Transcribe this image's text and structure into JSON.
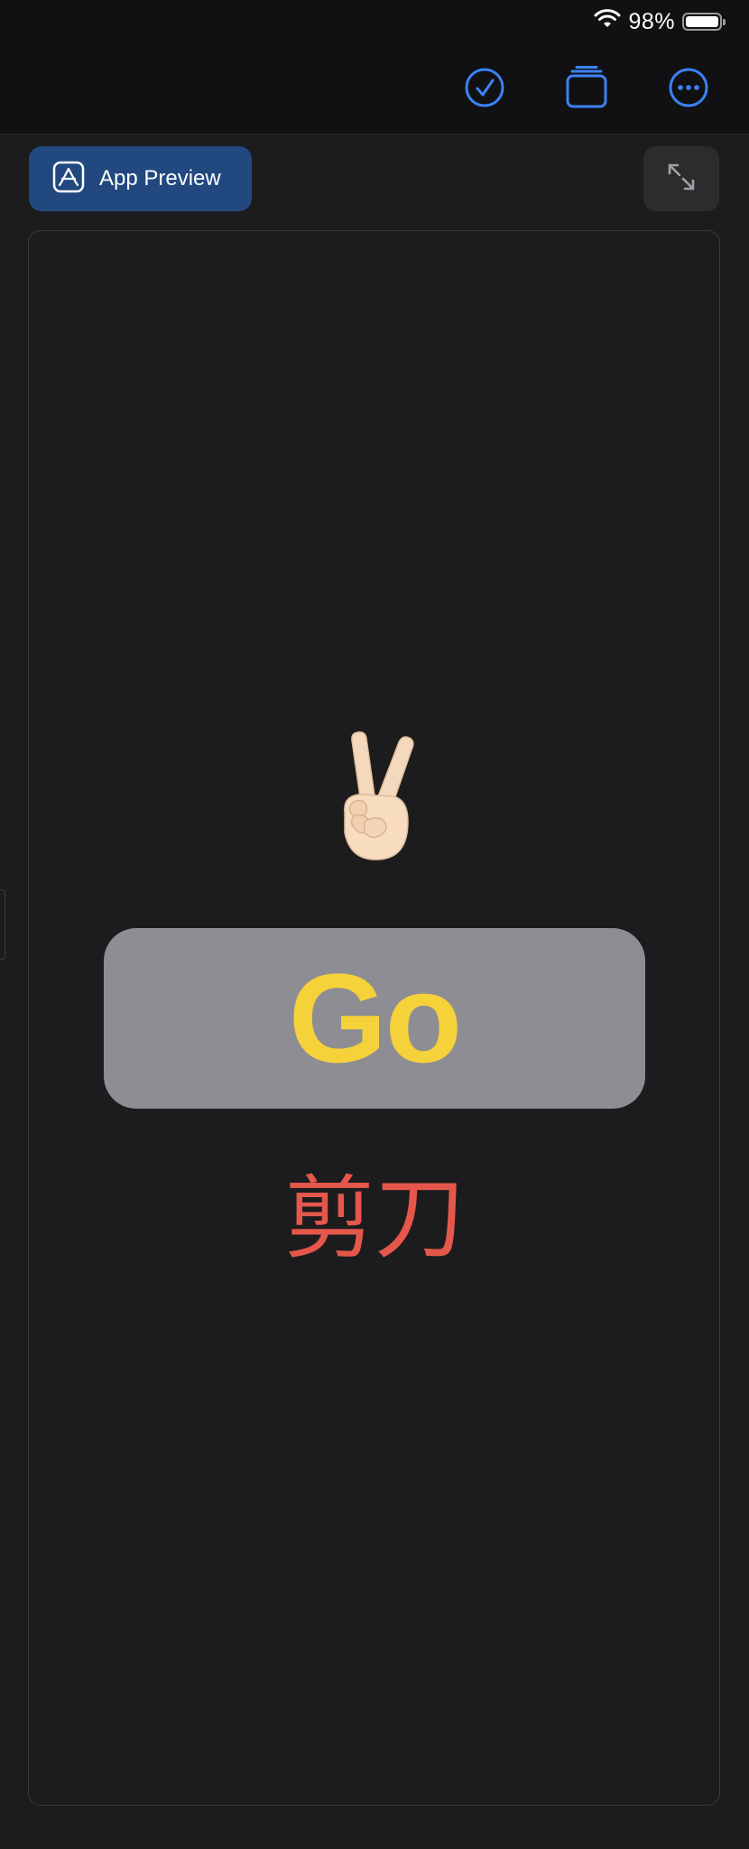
{
  "status_bar": {
    "battery_percent": "98%",
    "icons": [
      "wifi-icon",
      "battery-icon"
    ]
  },
  "toolbar": {
    "buttons": [
      {
        "name": "done",
        "icon": "checkmark-circle-icon"
      },
      {
        "name": "stack",
        "icon": "stacked-pages-icon"
      },
      {
        "name": "more",
        "icon": "ellipsis-circle-icon"
      }
    ],
    "accent_color": "#3b82f6"
  },
  "preview": {
    "app_preview_label": "App Preview",
    "app_preview_icon": "app-store-icon",
    "app_preview_color": "#21497f",
    "expand_icon": "expand-arrows-icon"
  },
  "game": {
    "hand_emoji": "✌🏻",
    "go_label": "Go",
    "go_color": "#f6d23a",
    "result_text": "剪刀",
    "result_color": "#e4574a"
  }
}
